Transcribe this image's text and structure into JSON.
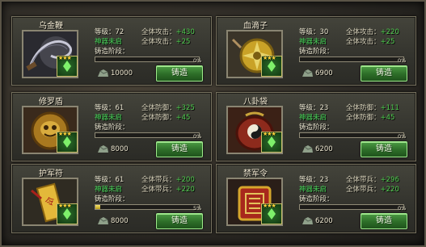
{
  "colors": {
    "stat_value": "#4ecb4e",
    "state_text": "#49d85a",
    "progress_fill": "#f0d84a",
    "button": "#3e8b37"
  },
  "labels": {
    "level": "等级：",
    "forge_stage": "铸造阶段：",
    "forge_button": "铸造"
  },
  "items": [
    {
      "name": "乌金鞭",
      "level": "72",
      "stat1_label": "全体攻击：",
      "stat1_value": "+430",
      "state": "神器未启",
      "stat2_label": "全体攻击：",
      "stat2_value": "+25",
      "progress": 0,
      "progress_text": "0%",
      "cost": "10000",
      "icon": "whip-icon"
    },
    {
      "name": "血滴子",
      "level": "30",
      "stat1_label": "全体攻击：",
      "stat1_value": "+220",
      "state": "神器未启",
      "stat2_label": "全体攻击：",
      "stat2_value": "+25",
      "progress": 0,
      "progress_text": "0%",
      "cost": "6900",
      "icon": "flying-guillotine-icon"
    },
    {
      "name": "修罗盾",
      "level": "61",
      "stat1_label": "全体防御：",
      "stat1_value": "+325",
      "state": "神器未启",
      "stat2_label": "全体防御：",
      "stat2_value": "+45",
      "progress": 0,
      "progress_text": "0%",
      "cost": "8000",
      "icon": "shield-icon"
    },
    {
      "name": "八卦袋",
      "level": "23",
      "stat1_label": "全体防御：",
      "stat1_value": "+111",
      "state": "神器未启",
      "stat2_label": "全体防御：",
      "stat2_value": "+45",
      "progress": 0,
      "progress_text": "0%",
      "cost": "6200",
      "icon": "bagua-bag-icon"
    },
    {
      "name": "护军符",
      "level": "61",
      "stat1_label": "全体带兵：",
      "stat1_value": "+200",
      "state": "神器未启",
      "stat2_label": "全体带兵：",
      "stat2_value": "+220",
      "progress": 0.05,
      "progress_text": "5%",
      "cost": "8000",
      "icon": "talisman-icon"
    },
    {
      "name": "禁军令",
      "level": "23",
      "stat1_label": "全体带兵：",
      "stat1_value": "+296",
      "state": "神器未启",
      "stat2_label": "全体带兵：",
      "stat2_value": "+220",
      "progress": 0,
      "progress_text": "0%",
      "cost": "6200",
      "icon": "command-token-icon"
    }
  ]
}
